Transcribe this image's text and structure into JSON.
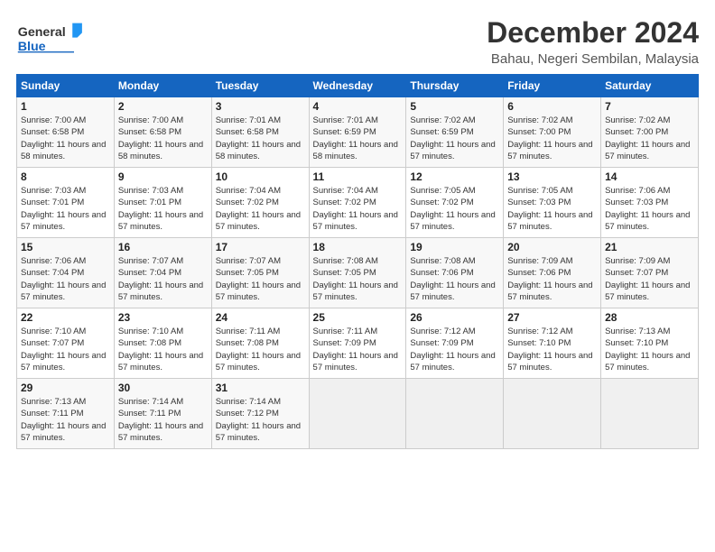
{
  "header": {
    "logo_general": "General",
    "logo_blue": "Blue",
    "title": "December 2024",
    "subtitle": "Bahau, Negeri Sembilan, Malaysia"
  },
  "calendar": {
    "days_of_week": [
      "Sunday",
      "Monday",
      "Tuesday",
      "Wednesday",
      "Thursday",
      "Friday",
      "Saturday"
    ],
    "weeks": [
      [
        {
          "day": "1",
          "sunrise": "7:00 AM",
          "sunset": "6:58 PM",
          "daylight": "11 hours and 58 minutes."
        },
        {
          "day": "2",
          "sunrise": "7:00 AM",
          "sunset": "6:58 PM",
          "daylight": "11 hours and 58 minutes."
        },
        {
          "day": "3",
          "sunrise": "7:01 AM",
          "sunset": "6:58 PM",
          "daylight": "11 hours and 58 minutes."
        },
        {
          "day": "4",
          "sunrise": "7:01 AM",
          "sunset": "6:59 PM",
          "daylight": "11 hours and 58 minutes."
        },
        {
          "day": "5",
          "sunrise": "7:02 AM",
          "sunset": "6:59 PM",
          "daylight": "11 hours and 57 minutes."
        },
        {
          "day": "6",
          "sunrise": "7:02 AM",
          "sunset": "7:00 PM",
          "daylight": "11 hours and 57 minutes."
        },
        {
          "day": "7",
          "sunrise": "7:02 AM",
          "sunset": "7:00 PM",
          "daylight": "11 hours and 57 minutes."
        }
      ],
      [
        {
          "day": "8",
          "sunrise": "7:03 AM",
          "sunset": "7:01 PM",
          "daylight": "11 hours and 57 minutes."
        },
        {
          "day": "9",
          "sunrise": "7:03 AM",
          "sunset": "7:01 PM",
          "daylight": "11 hours and 57 minutes."
        },
        {
          "day": "10",
          "sunrise": "7:04 AM",
          "sunset": "7:02 PM",
          "daylight": "11 hours and 57 minutes."
        },
        {
          "day": "11",
          "sunrise": "7:04 AM",
          "sunset": "7:02 PM",
          "daylight": "11 hours and 57 minutes."
        },
        {
          "day": "12",
          "sunrise": "7:05 AM",
          "sunset": "7:02 PM",
          "daylight": "11 hours and 57 minutes."
        },
        {
          "day": "13",
          "sunrise": "7:05 AM",
          "sunset": "7:03 PM",
          "daylight": "11 hours and 57 minutes."
        },
        {
          "day": "14",
          "sunrise": "7:06 AM",
          "sunset": "7:03 PM",
          "daylight": "11 hours and 57 minutes."
        }
      ],
      [
        {
          "day": "15",
          "sunrise": "7:06 AM",
          "sunset": "7:04 PM",
          "daylight": "11 hours and 57 minutes."
        },
        {
          "day": "16",
          "sunrise": "7:07 AM",
          "sunset": "7:04 PM",
          "daylight": "11 hours and 57 minutes."
        },
        {
          "day": "17",
          "sunrise": "7:07 AM",
          "sunset": "7:05 PM",
          "daylight": "11 hours and 57 minutes."
        },
        {
          "day": "18",
          "sunrise": "7:08 AM",
          "sunset": "7:05 PM",
          "daylight": "11 hours and 57 minutes."
        },
        {
          "day": "19",
          "sunrise": "7:08 AM",
          "sunset": "7:06 PM",
          "daylight": "11 hours and 57 minutes."
        },
        {
          "day": "20",
          "sunrise": "7:09 AM",
          "sunset": "7:06 PM",
          "daylight": "11 hours and 57 minutes."
        },
        {
          "day": "21",
          "sunrise": "7:09 AM",
          "sunset": "7:07 PM",
          "daylight": "11 hours and 57 minutes."
        }
      ],
      [
        {
          "day": "22",
          "sunrise": "7:10 AM",
          "sunset": "7:07 PM",
          "daylight": "11 hours and 57 minutes."
        },
        {
          "day": "23",
          "sunrise": "7:10 AM",
          "sunset": "7:08 PM",
          "daylight": "11 hours and 57 minutes."
        },
        {
          "day": "24",
          "sunrise": "7:11 AM",
          "sunset": "7:08 PM",
          "daylight": "11 hours and 57 minutes."
        },
        {
          "day": "25",
          "sunrise": "7:11 AM",
          "sunset": "7:09 PM",
          "daylight": "11 hours and 57 minutes."
        },
        {
          "day": "26",
          "sunrise": "7:12 AM",
          "sunset": "7:09 PM",
          "daylight": "11 hours and 57 minutes."
        },
        {
          "day": "27",
          "sunrise": "7:12 AM",
          "sunset": "7:10 PM",
          "daylight": "11 hours and 57 minutes."
        },
        {
          "day": "28",
          "sunrise": "7:13 AM",
          "sunset": "7:10 PM",
          "daylight": "11 hours and 57 minutes."
        }
      ],
      [
        {
          "day": "29",
          "sunrise": "7:13 AM",
          "sunset": "7:11 PM",
          "daylight": "11 hours and 57 minutes."
        },
        {
          "day": "30",
          "sunrise": "7:14 AM",
          "sunset": "7:11 PM",
          "daylight": "11 hours and 57 minutes."
        },
        {
          "day": "31",
          "sunrise": "7:14 AM",
          "sunset": "7:12 PM",
          "daylight": "11 hours and 57 minutes."
        },
        null,
        null,
        null,
        null
      ]
    ]
  }
}
